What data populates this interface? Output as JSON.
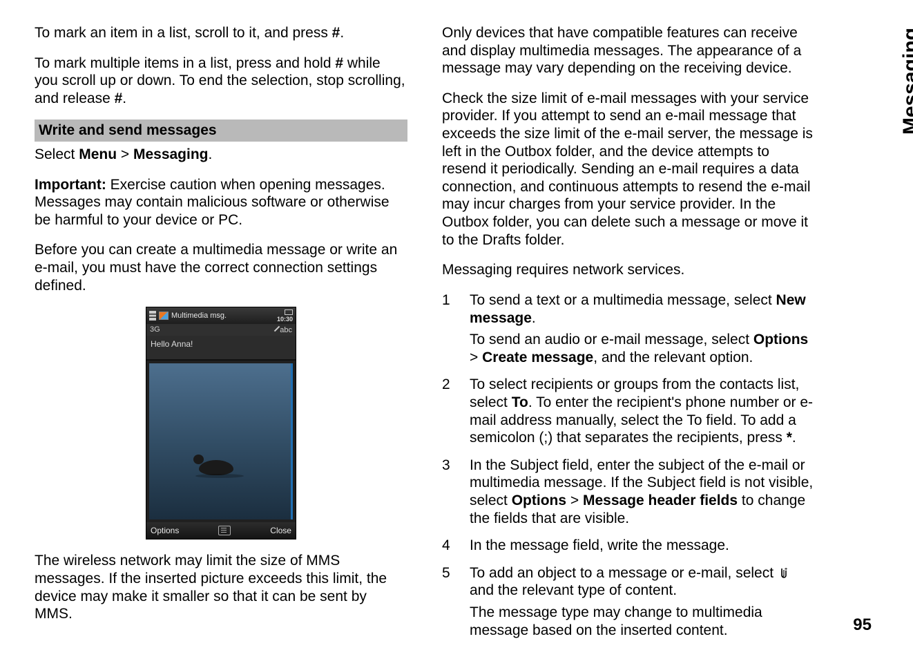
{
  "side_label": "Messaging",
  "page_number": "95",
  "left": {
    "p1_a": "To mark an item in a list, scroll to it, and press ",
    "p1_b": "#",
    "p1_c": ".",
    "p2_a": "To mark multiple items in a list, press and hold ",
    "p2_b": "#",
    "p2_c": " while you scroll up or down. To end the selection, stop scrolling, and release ",
    "p2_d": "#",
    "p2_e": ".",
    "section_header": "Write and send messages",
    "p3_a": "Select ",
    "p3_b": "Menu",
    "p3_c": " > ",
    "p3_d": "Messaging",
    "p3_e": ".",
    "p4_a": "Important: ",
    "p4_b": " Exercise caution when opening messages. Messages may contain malicious software or otherwise be harmful to your device or PC.",
    "p5": "Before you can create a multimedia message or write an e-mail, you must have the correct connection settings defined.",
    "p6": "The wireless network may limit the size of MMS messages. If the inserted picture exceeds this limit, the device may make it smaller so that it can be sent by MMS."
  },
  "phone": {
    "title": "Multimedia msg.",
    "clock": "10:30",
    "net": "3G",
    "mode": "abc",
    "hello": "Hello Anna!",
    "soft_left": "Options",
    "soft_right": "Close"
  },
  "right": {
    "p1": "Only devices that have compatible features can receive and display multimedia messages. The appearance of a message may vary depending on the receiving device.",
    "p2": "Check the size limit of e-mail messages with your service provider. If you attempt to send an e-mail message that exceeds the size limit of the e-mail server, the message is left in the Outbox folder, and the device attempts to resend it periodically. Sending an e-mail requires a data connection, and continuous attempts to resend the e-mail may incur charges from your service provider. In the Outbox folder, you can delete such a message or move it to the Drafts folder.",
    "p3": "Messaging requires network services.",
    "steps": {
      "s1": {
        "num": "1",
        "a": "To send a text or a multimedia message, select ",
        "b": "New message",
        "c": ".",
        "d": "To send an audio or e-mail message, select ",
        "e": "Options",
        "f": " > ",
        "g": "Create message",
        "h": ", and the relevant option."
      },
      "s2": {
        "num": "2",
        "a": "To select recipients or groups from the contacts list, select ",
        "b": "To",
        "c": ". To enter the recipient's phone number or e-mail address manually, select the To field. To add a semicolon (;) that separates the recipients, press ",
        "d": "*",
        "e": "."
      },
      "s3": {
        "num": "3",
        "a": "In the Subject field, enter the subject of the e-mail or multimedia message. If the Subject field is not visible, select ",
        "b": "Options",
        "c": " > ",
        "d": "Message header fields",
        "e": " to change the fields that are visible."
      },
      "s4": {
        "num": "4",
        "a": "In the message field, write the message."
      },
      "s5": {
        "num": "5",
        "a": "To add an object to a message or e-mail, select ",
        "b": " and the relevant type of content.",
        "c": "The message type may change to multimedia message based on the inserted content."
      }
    }
  }
}
